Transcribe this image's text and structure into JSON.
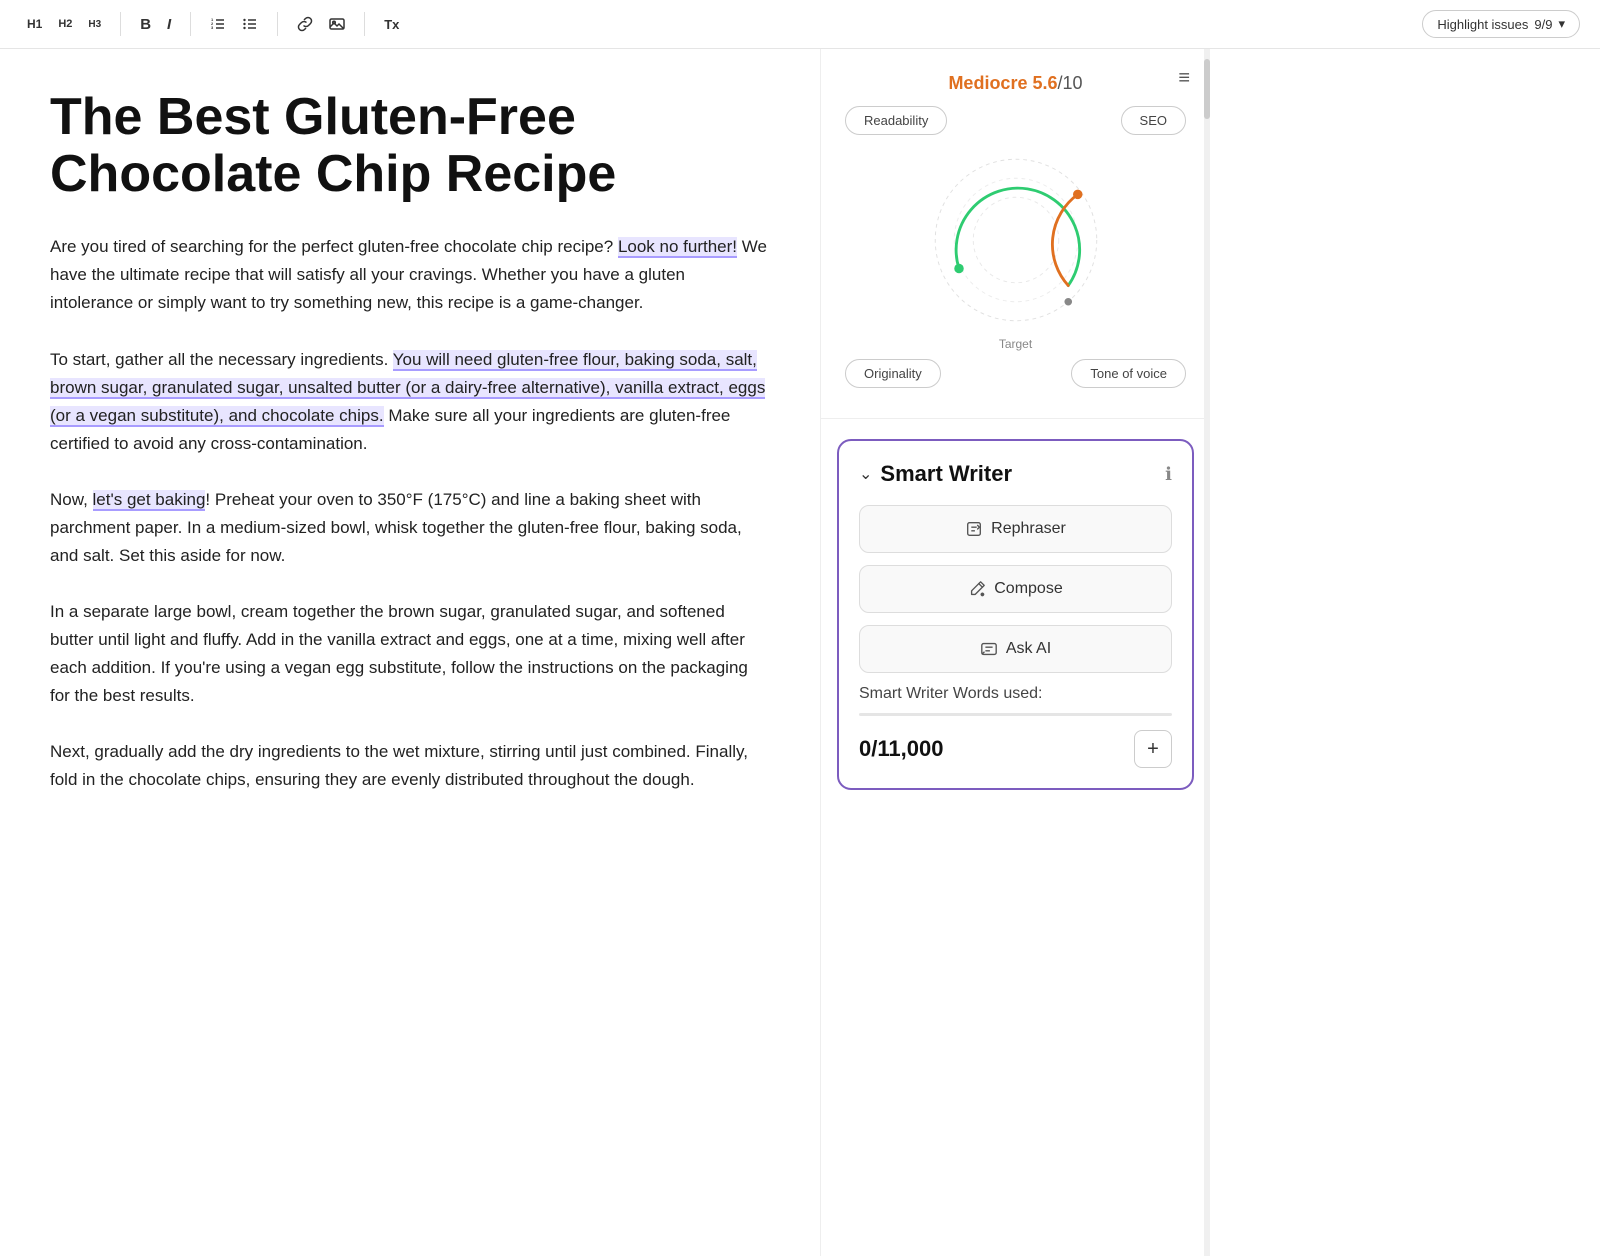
{
  "toolbar": {
    "h1_label": "H1",
    "h2_label": "H2",
    "h3_label": "H3",
    "bold_label": "B",
    "italic_label": "I",
    "clear_label": "Tx",
    "highlight_btn": "Highlight issues",
    "highlight_count": "9/9"
  },
  "editor": {
    "title": "The Best Gluten-Free Chocolate Chip Recipe",
    "paragraphs": [
      {
        "id": "p1",
        "text_parts": [
          {
            "text": "Are you tired of searching for the perfect gluten-free chocolate chip recipe? ",
            "type": "normal"
          },
          {
            "text": "Look no further!",
            "type": "highlight"
          },
          {
            "text": " We have the ultimate recipe that will satisfy all your cravings. Whether you have a gluten intolerance or simply want to try something new, this recipe is a game-changer.",
            "type": "normal"
          }
        ]
      },
      {
        "id": "p2",
        "text_parts": [
          {
            "text": "To start, gather all the necessary ingredients. ",
            "type": "normal"
          },
          {
            "text": "You will need gluten-free flour, baking soda, salt, brown sugar, granulated sugar, unsalted butter (or a dairy-free alternative), vanilla extract, eggs (or a vegan substitute), and chocolate chips.",
            "type": "highlight"
          },
          {
            "text": " Make sure all your ingredients are gluten-free certified to avoid any cross-contamination.",
            "type": "normal"
          }
        ]
      },
      {
        "id": "p3",
        "text_parts": [
          {
            "text": "Now, ",
            "type": "normal"
          },
          {
            "text": "let's get baking",
            "type": "highlight"
          },
          {
            "text": "! Preheat your oven to 350°F (175°C) and line a baking sheet with parchment paper. In a medium-sized bowl, whisk together the gluten-free flour, baking soda, and salt. Set this aside for now.",
            "type": "normal"
          }
        ]
      },
      {
        "id": "p4",
        "text_parts": [
          {
            "text": "In a separate large bowl, cream together the brown sugar, granulated sugar, and softened butter until light and fluffy. Add in the vanilla extract and eggs, one at a time, mixing well after each addition. If you're using a vegan egg substitute, follow the instructions on the packaging for the best results.",
            "type": "normal"
          }
        ]
      },
      {
        "id": "p5",
        "text_parts": [
          {
            "text": "Next, gradually add the dry ingredients to the wet mixture, stirring until just combined. Finally, fold in the chocolate chips, ensuring they are evenly distributed throughout the dough.",
            "type": "normal"
          }
        ]
      }
    ]
  },
  "score_panel": {
    "label_mediocre": "Mediocre",
    "score_value": "5.6",
    "score_denom": "/10",
    "tab_readability": "Readability",
    "tab_seo": "SEO",
    "tab_originality": "Originality",
    "tab_tone_of_voice": "Tone of voice",
    "target_label": "Target",
    "gauge": {
      "green_arc_degrees": 200,
      "orange_arc_degrees": 80,
      "green_dot_angle": 300,
      "orange_dot_angle": 50
    }
  },
  "smart_writer": {
    "title": "Smart Writer",
    "btn_rephraser": "Rephraser",
    "btn_compose": "Compose",
    "btn_ask_ai": "Ask AI",
    "words_label": "Smart Writer Words used:",
    "words_count": "0",
    "words_total": "/11,000",
    "plus_label": "+"
  }
}
